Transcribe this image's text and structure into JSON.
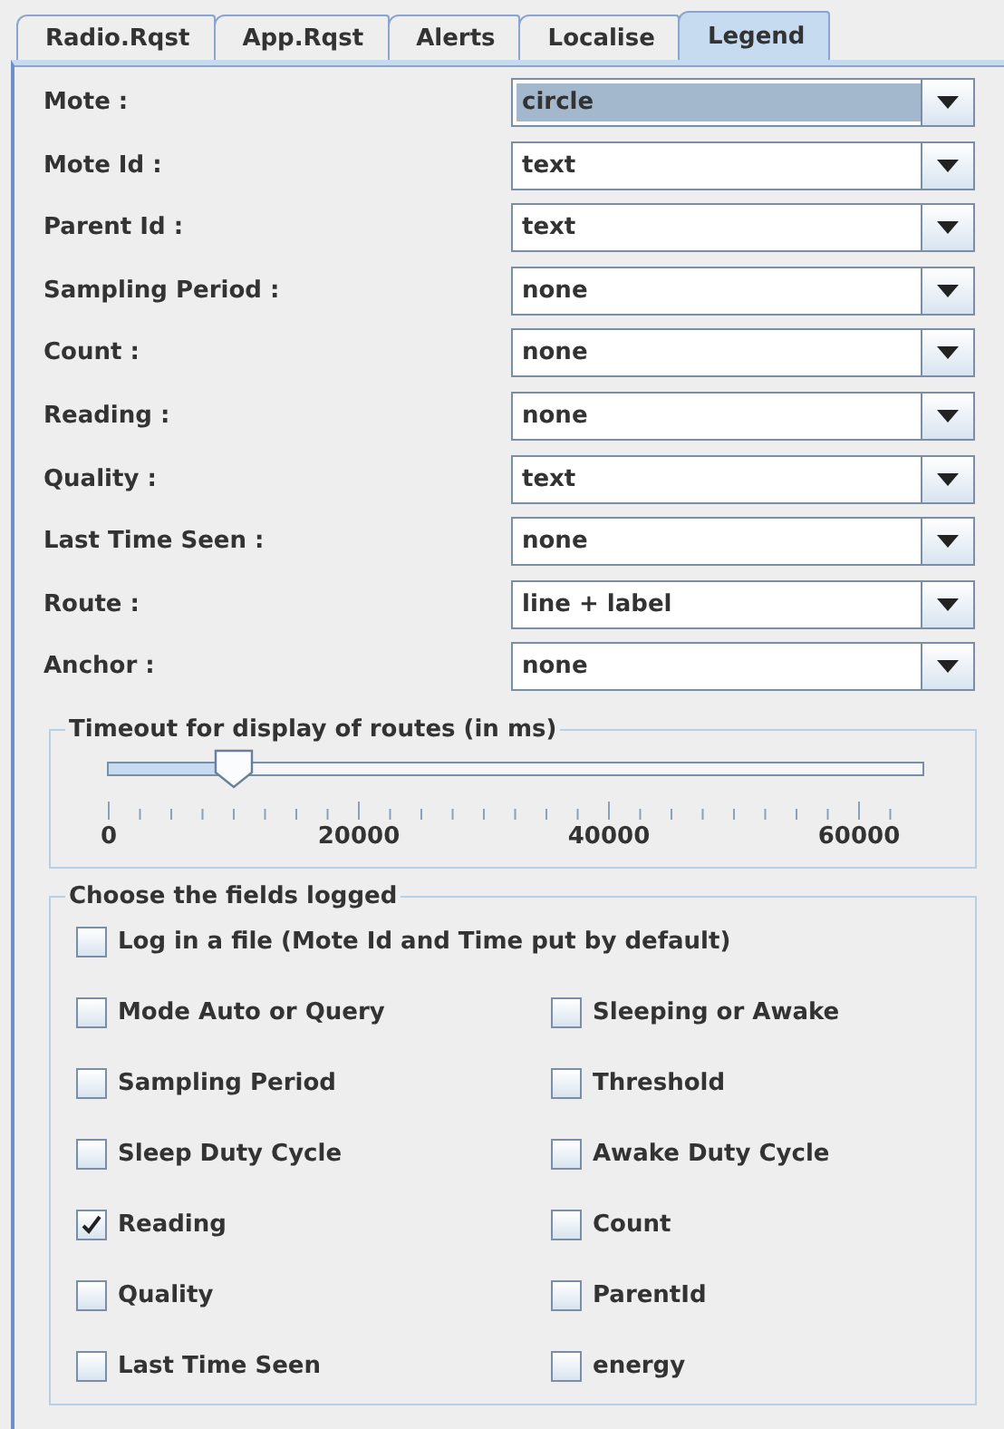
{
  "tabs": [
    {
      "label": "Radio.Rqst",
      "selected": false
    },
    {
      "label": "App.Rqst",
      "selected": false
    },
    {
      "label": "Alerts",
      "selected": false
    },
    {
      "label": "Localise",
      "selected": false
    },
    {
      "label": "Legend",
      "selected": true
    }
  ],
  "settings": [
    {
      "label": "Mote :",
      "value": "circle",
      "focused": true
    },
    {
      "label": "Mote Id :",
      "value": "text",
      "focused": false
    },
    {
      "label": "Parent Id :",
      "value": "text",
      "focused": false
    },
    {
      "label": "Sampling Period :",
      "value": "none",
      "focused": false
    },
    {
      "label": "Count :",
      "value": "none",
      "focused": false
    },
    {
      "label": "Reading :",
      "value": "none",
      "focused": false
    },
    {
      "label": "Quality :",
      "value": "text",
      "focused": false
    },
    {
      "label": "Last Time Seen :",
      "value": "none",
      "focused": false
    },
    {
      "label": "Route :",
      "value": "line + label",
      "focused": false
    },
    {
      "label": "Anchor :",
      "value": "none",
      "focused": false
    }
  ],
  "timeout": {
    "title": "Timeout for display of routes (in ms)",
    "level": 0.155,
    "tick_labels": [
      "0",
      "20000",
      "40000",
      "60000"
    ]
  },
  "fields_logged": {
    "title": "Choose the fields logged",
    "log_to_file": {
      "label": "Log in a file (Mote Id and Time put by default)",
      "checked": false
    },
    "options": [
      {
        "label": "Mode Auto or Query",
        "checked": false
      },
      {
        "label": "Sleeping or Awake",
        "checked": false
      },
      {
        "label": "Sampling Period",
        "checked": false
      },
      {
        "label": "Threshold",
        "checked": false
      },
      {
        "label": "Sleep Duty Cycle",
        "checked": false
      },
      {
        "label": "Awake Duty Cycle",
        "checked": false
      },
      {
        "label": "Reading",
        "checked": true
      },
      {
        "label": "Count",
        "checked": false
      },
      {
        "label": "Quality",
        "checked": false
      },
      {
        "label": "ParentId",
        "checked": false
      },
      {
        "label": "Last Time Seen",
        "checked": false
      },
      {
        "label": "energy",
        "checked": false
      }
    ]
  }
}
